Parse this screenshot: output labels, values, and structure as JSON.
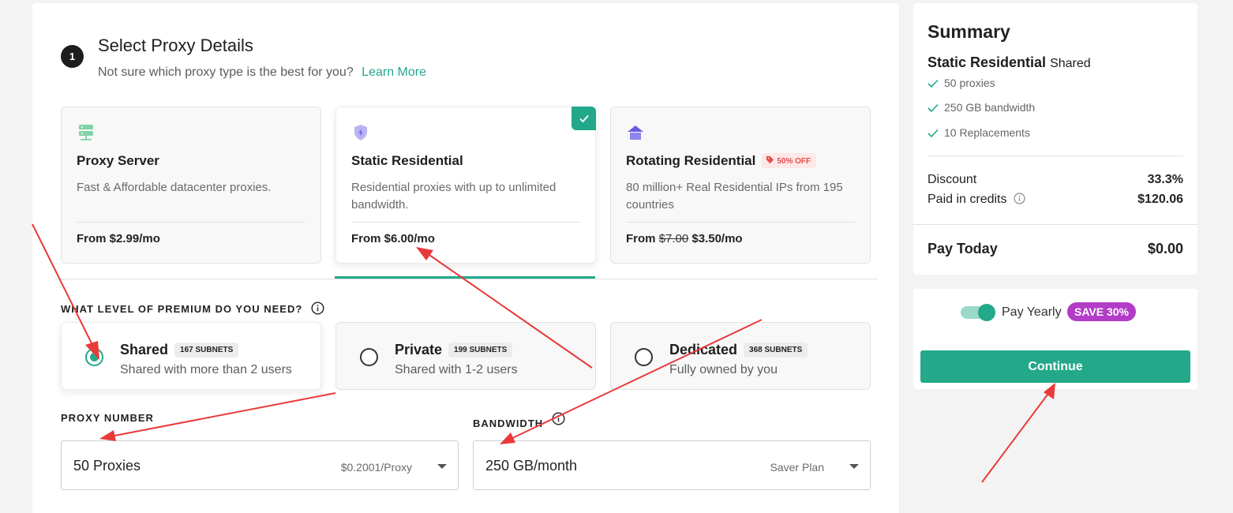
{
  "step": {
    "number": "1",
    "title": "Select Proxy Details",
    "subtitle": "Not sure which proxy type is the best for you?",
    "learn_more": "Learn More"
  },
  "proxy_types": [
    {
      "title": "Proxy Server",
      "description": "Fast & Affordable datacenter proxies.",
      "price": "From $2.99/mo",
      "icon": "server-icon",
      "selected": false
    },
    {
      "title": "Static Residential",
      "description": "Residential proxies with up to unlimited bandwidth.",
      "price": "From $6.00/mo",
      "icon": "shield-icon",
      "selected": true
    },
    {
      "title": "Rotating Residential",
      "badge": "50% OFF",
      "description": "80 million+ Real Residential IPs from 195 countries",
      "price_prefix": "From",
      "price_old": "$7.00",
      "price_new": "$3.50/mo",
      "icon": "house-icon",
      "selected": false
    }
  ],
  "premium": {
    "label": "WHAT LEVEL OF PREMIUM DO YOU NEED?",
    "options": [
      {
        "title": "Shared",
        "badge": "167 SUBNETS",
        "description": "Shared with more than 2 users",
        "selected": true
      },
      {
        "title": "Private",
        "badge": "199 SUBNETS",
        "description": "Shared with 1-2 users",
        "selected": false
      },
      {
        "title": "Dedicated",
        "badge": "368 SUBNETS",
        "description": "Fully owned by you",
        "selected": false
      }
    ]
  },
  "proxy_number": {
    "label": "PROXY NUMBER",
    "value": "50 Proxies",
    "hint": "$0.2001/Proxy"
  },
  "bandwidth": {
    "label": "BANDWIDTH",
    "value": "250 GB/month",
    "hint": "Saver Plan"
  },
  "summary": {
    "title": "Summary",
    "product": "Static Residential",
    "variant": "Shared",
    "features": [
      "50 proxies",
      "250 GB bandwidth",
      "10 Replacements"
    ],
    "discount_label": "Discount",
    "discount_value": "33.3%",
    "credits_label": "Paid in credits",
    "credits_value": "$120.06",
    "pay_today_label": "Pay Today",
    "pay_today_value": "$0.00"
  },
  "billing": {
    "toggle_label": "Pay Yearly",
    "toggle_on": true,
    "save_badge": "SAVE 30%",
    "continue_label": "Continue"
  },
  "colors": {
    "accent": "#23a88a",
    "badge_purple": "#b23cc6",
    "annotation_red": "#e83a3a"
  }
}
